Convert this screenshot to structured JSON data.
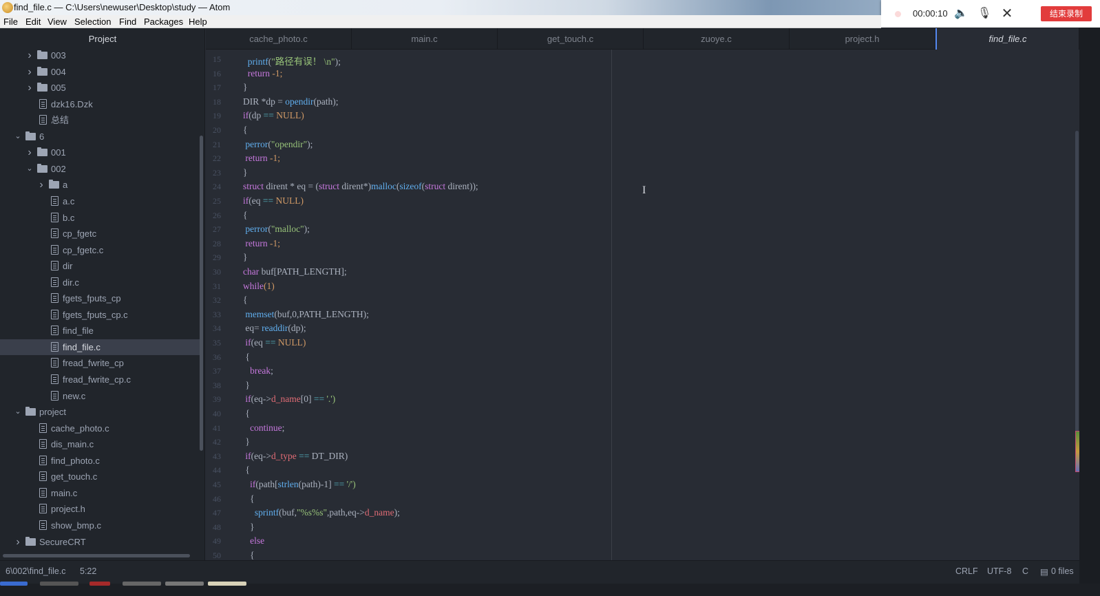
{
  "window": {
    "title": "find_file.c — C:\\Users\\newuser\\Desktop\\study — Atom"
  },
  "recorder": {
    "time": "00:00:10",
    "stop_label": "结束录制"
  },
  "menu": [
    "File",
    "Edit",
    "View",
    "Selection",
    "Find",
    "Packages",
    "Help"
  ],
  "sidebar": {
    "title": "Project",
    "items": [
      {
        "label": "003",
        "type": "folder",
        "expanded": false,
        "depth": 2
      },
      {
        "label": "004",
        "type": "folder",
        "expanded": false,
        "depth": 2
      },
      {
        "label": "005",
        "type": "folder",
        "expanded": false,
        "depth": 2
      },
      {
        "label": "dzk16.Dzk",
        "type": "file",
        "depth": 2
      },
      {
        "label": "总结",
        "type": "file",
        "depth": 2
      },
      {
        "label": "6",
        "type": "folder",
        "expanded": true,
        "depth": 1
      },
      {
        "label": "001",
        "type": "folder",
        "expanded": false,
        "depth": 2
      },
      {
        "label": "002",
        "type": "folder",
        "expanded": true,
        "depth": 2
      },
      {
        "label": "a",
        "type": "folder",
        "expanded": false,
        "depth": 3
      },
      {
        "label": "a.c",
        "type": "file",
        "depth": 3
      },
      {
        "label": "b.c",
        "type": "file",
        "depth": 3
      },
      {
        "label": "cp_fgetc",
        "type": "file",
        "depth": 3
      },
      {
        "label": "cp_fgetc.c",
        "type": "file",
        "depth": 3
      },
      {
        "label": "dir",
        "type": "file",
        "depth": 3
      },
      {
        "label": "dir.c",
        "type": "file",
        "depth": 3
      },
      {
        "label": "fgets_fputs_cp",
        "type": "file",
        "depth": 3
      },
      {
        "label": "fgets_fputs_cp.c",
        "type": "file",
        "depth": 3
      },
      {
        "label": "find_file",
        "type": "file",
        "depth": 3
      },
      {
        "label": "find_file.c",
        "type": "file",
        "depth": 3,
        "selected": true
      },
      {
        "label": "fread_fwrite_cp",
        "type": "file",
        "depth": 3
      },
      {
        "label": "fread_fwrite_cp.c",
        "type": "file",
        "depth": 3
      },
      {
        "label": "new.c",
        "type": "file",
        "depth": 3
      },
      {
        "label": "project",
        "type": "folder",
        "expanded": true,
        "depth": 1
      },
      {
        "label": "cache_photo.c",
        "type": "file",
        "depth": 2
      },
      {
        "label": "dis_main.c",
        "type": "file",
        "depth": 2
      },
      {
        "label": "find_photo.c",
        "type": "file",
        "depth": 2
      },
      {
        "label": "get_touch.c",
        "type": "file",
        "depth": 2
      },
      {
        "label": "main.c",
        "type": "file",
        "depth": 2
      },
      {
        "label": "project.h",
        "type": "file",
        "depth": 2
      },
      {
        "label": "show_bmp.c",
        "type": "file",
        "depth": 2
      },
      {
        "label": "SecureCRT",
        "type": "folder",
        "expanded": false,
        "depth": 1
      }
    ]
  },
  "tabs": [
    {
      "label": "cache_photo.c"
    },
    {
      "label": "main.c"
    },
    {
      "label": "get_touch.c"
    },
    {
      "label": "zuoye.c"
    },
    {
      "label": "project.h"
    },
    {
      "label": "find_file.c",
      "active": true
    }
  ],
  "editor": {
    "lines": [
      {
        "n": "15",
        "code": [
          [
            "  ",
            ""
          ],
          [
            "printf",
            "fn"
          ],
          [
            "(",
            ""
          ],
          [
            "\"路径有误！ \\n\"",
            "str"
          ],
          [
            ");",
            ""
          ]
        ]
      },
      {
        "n": "16",
        "code": [
          [
            "  ",
            ""
          ],
          [
            "return",
            "kw"
          ],
          [
            " -1;",
            "num"
          ]
        ]
      },
      {
        "n": "17",
        "code": [
          [
            "}",
            ""
          ]
        ]
      },
      {
        "n": "18",
        "code": [
          [
            "DIR ",
            ""
          ],
          [
            "*",
            ""
          ],
          [
            "dp = ",
            ""
          ],
          [
            "opendir",
            "fn"
          ],
          [
            "(path);",
            ""
          ]
        ]
      },
      {
        "n": "19",
        "code": [
          [
            "if",
            "kw"
          ],
          [
            "(dp ",
            ""
          ],
          [
            "==",
            "op"
          ],
          [
            " NULL)",
            "const"
          ]
        ]
      },
      {
        "n": "20",
        "code": [
          [
            "{",
            ""
          ]
        ]
      },
      {
        "n": "21",
        "code": [
          [
            " ",
            ""
          ],
          [
            "perror",
            "fn"
          ],
          [
            "(",
            ""
          ],
          [
            "\"opendir\"",
            "str"
          ],
          [
            ");",
            ""
          ]
        ]
      },
      {
        "n": "22",
        "code": [
          [
            " ",
            ""
          ],
          [
            "return",
            "kw"
          ],
          [
            " -1;",
            "num"
          ]
        ]
      },
      {
        "n": "23",
        "code": [
          [
            "}",
            ""
          ]
        ]
      },
      {
        "n": "24",
        "code": [
          [
            "struct",
            "kw"
          ],
          [
            " dirent * eq = (",
            ""
          ],
          [
            "struct",
            "kw"
          ],
          [
            " dirent*)",
            ""
          ],
          [
            "malloc",
            "fn"
          ],
          [
            "(",
            ""
          ],
          [
            "sizeof",
            "fn"
          ],
          [
            "(",
            ""
          ],
          [
            "struct",
            "kw"
          ],
          [
            " dirent));",
            ""
          ]
        ]
      },
      {
        "n": "25",
        "code": [
          [
            "if",
            "kw"
          ],
          [
            "(eq ",
            ""
          ],
          [
            "==",
            "op"
          ],
          [
            " NULL)",
            "const"
          ]
        ]
      },
      {
        "n": "26",
        "code": [
          [
            "{",
            ""
          ]
        ]
      },
      {
        "n": "27",
        "code": [
          [
            " ",
            ""
          ],
          [
            "perror",
            "fn"
          ],
          [
            "(",
            ""
          ],
          [
            "\"malloc\"",
            "str"
          ],
          [
            ");",
            ""
          ]
        ]
      },
      {
        "n": "28",
        "code": [
          [
            " ",
            ""
          ],
          [
            "return",
            "kw"
          ],
          [
            " -1;",
            "num"
          ]
        ]
      },
      {
        "n": "29",
        "code": [
          [
            "}",
            ""
          ]
        ]
      },
      {
        "n": "30",
        "code": [
          [
            "char",
            "kw"
          ],
          [
            " buf[PATH_LENGTH];",
            ""
          ]
        ]
      },
      {
        "n": "31",
        "code": [
          [
            "while",
            "kw"
          ],
          [
            "(1)",
            "num"
          ]
        ]
      },
      {
        "n": "32",
        "code": [
          [
            "{",
            ""
          ]
        ]
      },
      {
        "n": "33",
        "code": [
          [
            " ",
            ""
          ],
          [
            "memset",
            "fn"
          ],
          [
            "(buf,0,PATH_LENGTH);",
            ""
          ]
        ]
      },
      {
        "n": "34",
        "code": [
          [
            " eq= ",
            ""
          ],
          [
            "readdir",
            "fn"
          ],
          [
            "(dp);",
            ""
          ]
        ]
      },
      {
        "n": "35",
        "code": [
          [
            " ",
            ""
          ],
          [
            "if",
            "kw"
          ],
          [
            "(eq ",
            ""
          ],
          [
            "==",
            "op"
          ],
          [
            " NULL)",
            "const"
          ]
        ]
      },
      {
        "n": "36",
        "code": [
          [
            " {",
            ""
          ]
        ]
      },
      {
        "n": "37",
        "code": [
          [
            "   ",
            ""
          ],
          [
            "break",
            "kw"
          ],
          [
            ";",
            ""
          ]
        ]
      },
      {
        "n": "38",
        "code": [
          [
            " }",
            ""
          ]
        ]
      },
      {
        "n": "39",
        "code": [
          [
            " ",
            ""
          ],
          [
            "if",
            "kw"
          ],
          [
            "(eq->",
            ""
          ],
          [
            "d_name",
            "var"
          ],
          [
            "[0] ",
            ""
          ],
          [
            "==",
            "op"
          ],
          [
            " '.')",
            "str"
          ]
        ]
      },
      {
        "n": "40",
        "code": [
          [
            " {",
            ""
          ]
        ]
      },
      {
        "n": "41",
        "code": [
          [
            "   ",
            ""
          ],
          [
            "continue",
            "kw"
          ],
          [
            ";",
            ""
          ]
        ]
      },
      {
        "n": "42",
        "code": [
          [
            " }",
            ""
          ]
        ]
      },
      {
        "n": "43",
        "code": [
          [
            " ",
            ""
          ],
          [
            "if",
            "kw"
          ],
          [
            "(eq->",
            ""
          ],
          [
            "d_type",
            "var"
          ],
          [
            " ",
            ""
          ],
          [
            "==",
            "op"
          ],
          [
            " DT_DIR)",
            ""
          ]
        ]
      },
      {
        "n": "44",
        "code": [
          [
            " {",
            ""
          ]
        ]
      },
      {
        "n": "45",
        "code": [
          [
            "   ",
            ""
          ],
          [
            "if",
            "kw"
          ],
          [
            "(path[",
            ""
          ],
          [
            "strlen",
            "fn"
          ],
          [
            "(path)-1] ",
            ""
          ],
          [
            "==",
            "op"
          ],
          [
            " '/')",
            "str"
          ]
        ]
      },
      {
        "n": "46",
        "code": [
          [
            "   {",
            ""
          ]
        ]
      },
      {
        "n": "47",
        "code": [
          [
            "     ",
            ""
          ],
          [
            "sprintf",
            "fn"
          ],
          [
            "(buf,",
            ""
          ],
          [
            "\"%s%s\"",
            "str"
          ],
          [
            ",path,eq->",
            ""
          ],
          [
            "d_name",
            "var"
          ],
          [
            ");",
            ""
          ]
        ]
      },
      {
        "n": "48",
        "code": [
          [
            "   }",
            ""
          ]
        ]
      },
      {
        "n": "49",
        "code": [
          [
            "   ",
            ""
          ],
          [
            "else",
            "kw"
          ]
        ]
      },
      {
        "n": "50",
        "code": [
          [
            "   {",
            ""
          ]
        ]
      }
    ]
  },
  "status": {
    "path": "6\\002\\find_file.c",
    "position": "5:22",
    "line_ending": "CRLF",
    "encoding": "UTF-8",
    "grammar": "C",
    "files": "0 files"
  },
  "colors": {
    "kw": "#c678dd",
    "fn": "#61afef",
    "str": "#98c379",
    "num": "#d19a66",
    "const": "#d19a66",
    "var": "#e06c75",
    "op": "#56b6c2",
    "": "#abb2bf"
  }
}
